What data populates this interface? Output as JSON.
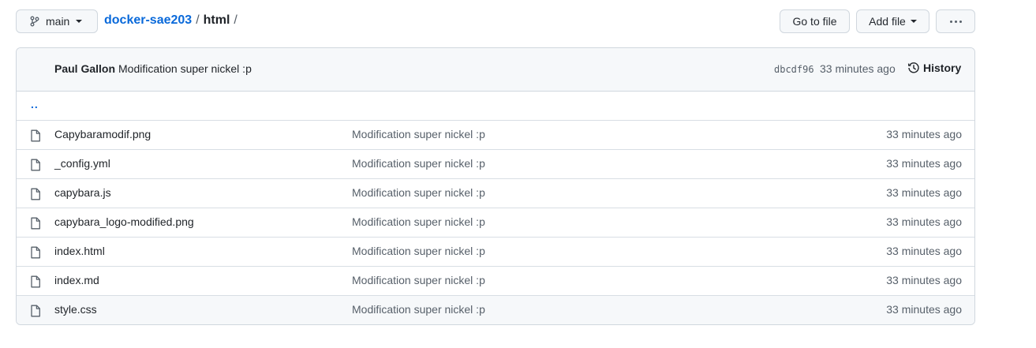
{
  "toolbar": {
    "branch": "main",
    "breadcrumb": {
      "repo": "docker-sae203",
      "sep1": "/",
      "folder": "html",
      "sep2": "/"
    },
    "goto_file": "Go to file",
    "add_file": "Add file"
  },
  "commit": {
    "author": "Paul Gallon",
    "message": "Modification super nickel :p",
    "sha": "dbcdf96",
    "time": "33 minutes ago",
    "history_label": "History"
  },
  "updir": "..",
  "files": [
    {
      "name": "Capybaramodif.png",
      "message": "Modification super nickel :p",
      "time": "33 minutes ago"
    },
    {
      "name": "_config.yml",
      "message": "Modification super nickel :p",
      "time": "33 minutes ago"
    },
    {
      "name": "capybara.js",
      "message": "Modification super nickel :p",
      "time": "33 minutes ago"
    },
    {
      "name": "capybara_logo-modified.png",
      "message": "Modification super nickel :p",
      "time": "33 minutes ago"
    },
    {
      "name": "index.html",
      "message": "Modification super nickel :p",
      "time": "33 minutes ago"
    },
    {
      "name": "index.md",
      "message": "Modification super nickel :p",
      "time": "33 minutes ago"
    },
    {
      "name": "style.css",
      "message": "Modification super nickel :p",
      "time": "33 minutes ago"
    }
  ],
  "colors": {
    "link": "#0969da",
    "muted": "#57606a",
    "border": "#d0d7de",
    "header_bg": "#f6f8fa"
  },
  "icons": [
    "git-branch-icon",
    "caret-down-icon",
    "kebab-horizontal-icon",
    "history-icon",
    "file-icon"
  ]
}
